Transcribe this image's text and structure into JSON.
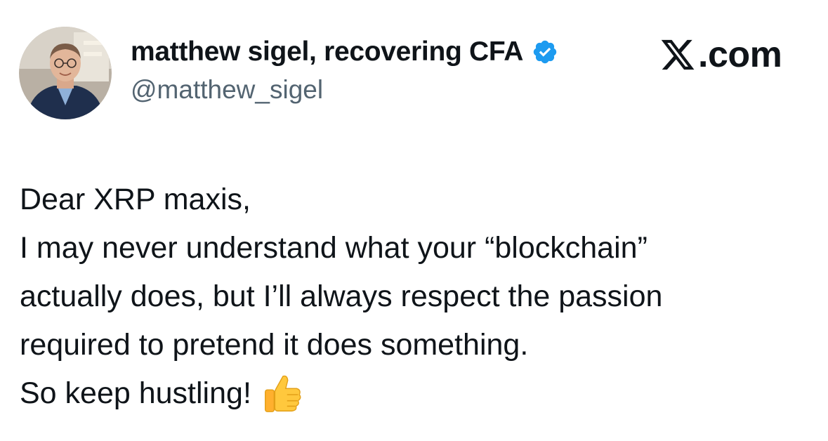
{
  "author": {
    "display_name": "matthew sigel, recovering CFA",
    "handle": "@matthew_sigel",
    "verified_color": "#1d9bf0"
  },
  "brand": {
    "logo_icon": "x-logo-icon",
    "suffix": ".com"
  },
  "tweet": {
    "lines": [
      "Dear XRP maxis,",
      "I may never understand what your “blockchain”",
      "actually does, but I’ll always respect the passion",
      "required to pretend it does something.",
      "So keep hustling!"
    ],
    "emoji_icon": "thumbs-up-icon"
  },
  "colors": {
    "text_primary": "#0f1419",
    "text_secondary": "#536471",
    "emoji": "#ffc83d"
  }
}
